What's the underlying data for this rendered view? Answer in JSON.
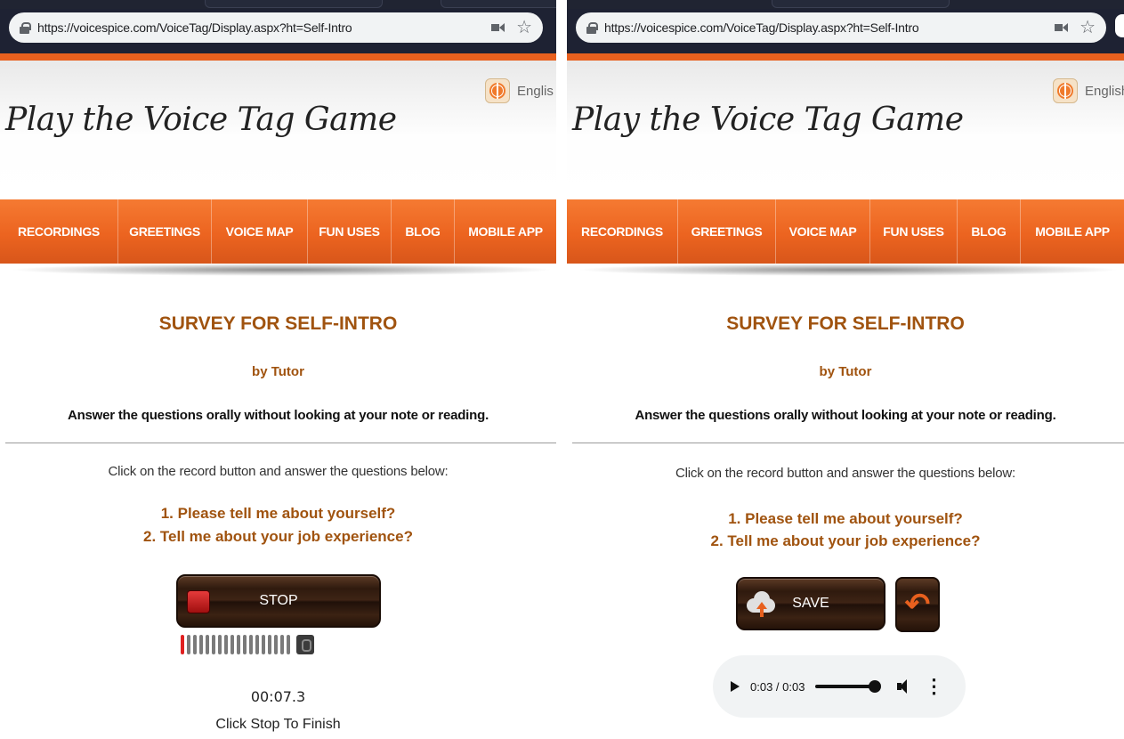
{
  "browser": {
    "url": "https://voicespice.com/VoiceTag/Display.aspx?ht=Self-Intro"
  },
  "site": {
    "logo_text": "Play the Voice Tag Game",
    "language_left": "Englis",
    "language_right": "English",
    "nav": [
      "RECORDINGS",
      "GREETINGS",
      "VOICE MAP",
      "FUN USES",
      "BLOG",
      "MOBILE APP"
    ]
  },
  "survey": {
    "title": "SURVEY FOR SELF-INTRO",
    "by": "by Tutor",
    "instruction": "Answer the questions orally without looking at your note or reading.",
    "click_prompt": "Click on the record button and answer the questions below:",
    "q1": "1. Please tell me about yourself?",
    "q2": "2. Tell me about your job experience?"
  },
  "recorder_left": {
    "stop_label": "STOP",
    "timer": "00:07.3",
    "status": "Click Stop To Finish",
    "meter_level_bars": 1,
    "meter_total_bars": 18
  },
  "recorder_right": {
    "save_label": "SAVE",
    "audio_time": "0:03 / 0:03",
    "audio_progress": 1.0
  },
  "colors": {
    "nav_orange": "#ec6420",
    "title_brown": "#a0530f"
  }
}
